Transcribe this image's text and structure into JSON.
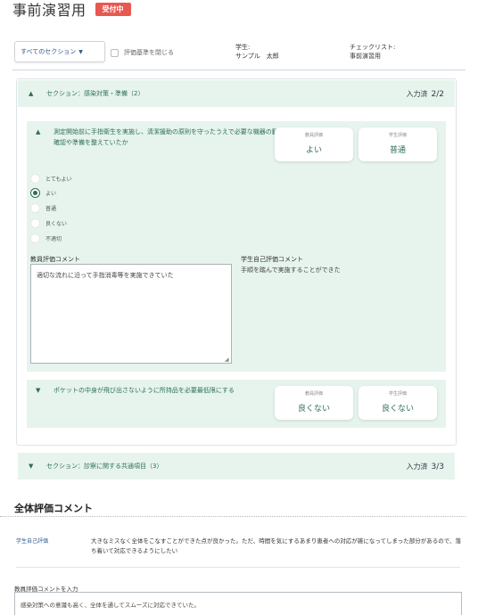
{
  "header": {
    "title": "事前演習用",
    "badge": "受付中"
  },
  "toolbar": {
    "section_select_value": "すべてのセクション",
    "hide_criteria_label": "評価基準を閉じる",
    "hide_criteria_checked": false,
    "student_label": "学生:",
    "student_name": "サンプル　太郎",
    "checklist_label": "チェックリスト:",
    "checklist_name": "事前演習用"
  },
  "sections": [
    {
      "title": "セクション：感染対策・準備（2）",
      "progress_label": "入力済",
      "progress": "2/2",
      "expanded": true,
      "items": [
        {
          "question": "測定開始前に手指衛生を実施し、清潔援助の原則を守ったうえで必要な機器の動作確認や準備を整えていたか",
          "teacher_eval_caption": "教員評価",
          "teacher_eval_value": "よい",
          "student_eval_caption": "学生評価",
          "student_eval_value": "普通",
          "options": [
            "とてもよい",
            "よい",
            "普通",
            "良くない",
            "不適切"
          ],
          "selected_option": "よい",
          "teacher_comment_label": "教員評価コメント",
          "teacher_comment": "適切な流れに沿って手指消毒等を実施できていた",
          "student_comment_label": "学生自己評価コメント",
          "student_comment": "手順を踏んで実施することができた"
        },
        {
          "question": "ポケットの中身が飛び出さないように所持品を必要最低限にする",
          "teacher_eval_caption": "教員評価",
          "teacher_eval_value": "良くない",
          "student_eval_caption": "学生評価",
          "student_eval_value": "良くない"
        }
      ]
    },
    {
      "title": "セクション：診察に関する共通項目（3）",
      "progress_label": "入力済",
      "progress": "3/3",
      "expanded": false
    }
  ],
  "overall": {
    "title": "全体評価コメント",
    "self_label": "学生自己評価",
    "self_text": "大きなミスなく全体をこなすことができた点が良かった。ただ、時間を気にするあまり患者への対応が雑になってしまった部分があるので、落ち着いて対応できるようにしたい",
    "teacher_input_label": "教員評価コメントを入力",
    "teacher_input_value": "感染対策への意識も高く、全体を通してスムーズに対応できていた。"
  },
  "colors": {
    "accent_green": "#2f6e56",
    "panel_green": "#e6f4ed",
    "badge_red": "#e8584f",
    "link_blue": "#2e5a8f"
  }
}
